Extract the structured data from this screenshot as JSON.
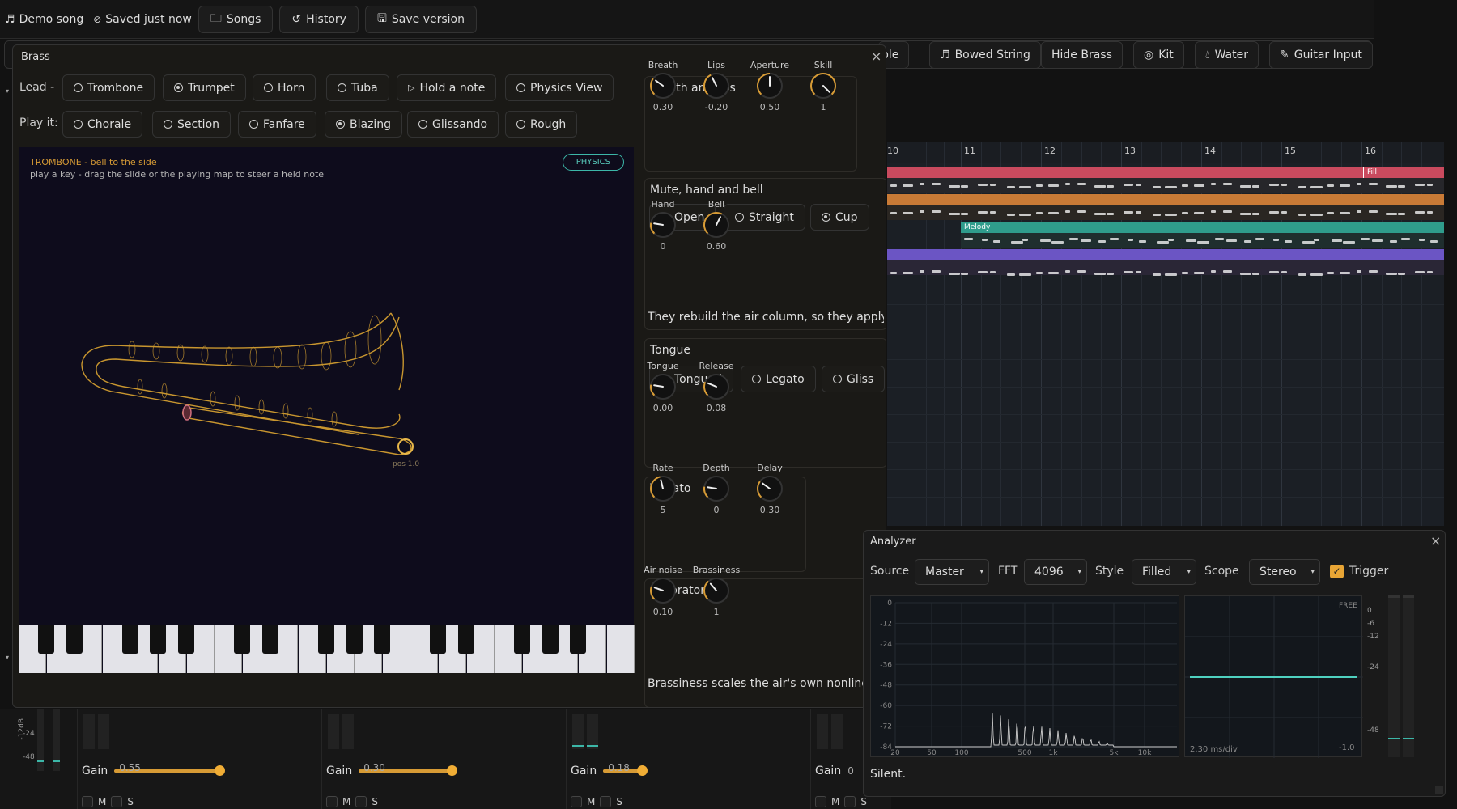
{
  "topbar": {
    "song_title": "Demo song",
    "saved_status": "Saved just now",
    "songs_label": "Songs",
    "history_label": "History",
    "save_version_label": "Save version"
  },
  "presets": {
    "partial_label": "ble",
    "bowed_string": "Bowed String",
    "hide_brass": "Hide Brass",
    "kit": "Kit",
    "water": "Water",
    "guitar_input": "Guitar Input"
  },
  "brass": {
    "title": "Brass",
    "lead_label": "Lead -",
    "lead_options": [
      {
        "label": "Trombone",
        "selected": false
      },
      {
        "label": "Trumpet",
        "selected": true
      },
      {
        "label": "Horn",
        "selected": false
      },
      {
        "label": "Tuba",
        "selected": false
      }
    ],
    "hold_note_label": "Hold a note",
    "physics_view_label": "Physics View",
    "play_it_label": "Play it:",
    "play_options": [
      {
        "label": "Chorale",
        "selected": false
      },
      {
        "label": "Section",
        "selected": false
      },
      {
        "label": "Fanfare",
        "selected": false
      },
      {
        "label": "Blazing",
        "selected": true
      },
      {
        "label": "Glissando",
        "selected": false
      },
      {
        "label": "Rough",
        "selected": false
      }
    ],
    "stage": {
      "instrument_line": "TROMBONE  -  bell to the side",
      "hint_line": "play a key - drag the slide or the playing map to steer a held note",
      "physics_badge": "PHYSICS",
      "pos_label": "pos 1.0"
    },
    "breath_and_lips": {
      "title": "Breath and lips",
      "knobs": [
        {
          "label": "Breath",
          "value": "0.30",
          "level": 0.3
        },
        {
          "label": "Lips",
          "value": "-0.20",
          "level": 0.4
        },
        {
          "label": "Aperture",
          "value": "0.50",
          "level": 0.5
        },
        {
          "label": "Skill",
          "value": "1",
          "level": 1.0
        }
      ]
    },
    "mute_hand_bell": {
      "title": "Mute, hand and bell",
      "options": [
        {
          "label": "Open",
          "selected": false
        },
        {
          "label": "Straight",
          "selected": false
        },
        {
          "label": "Cup",
          "selected": true
        }
      ],
      "knobs": [
        {
          "label": "Hand",
          "value": "0",
          "level": 0.2
        },
        {
          "label": "Bell",
          "value": "0.60",
          "level": 0.6
        }
      ],
      "note": "They rebuild the air column, so they apply f"
    },
    "tongue": {
      "title": "Tongue",
      "options": [
        {
          "label": "Tongued",
          "selected": true
        },
        {
          "label": "Legato",
          "selected": false
        },
        {
          "label": "Gliss",
          "selected": false
        }
      ],
      "knobs": [
        {
          "label": "Tongue",
          "value": "0.00",
          "level": 0.2
        },
        {
          "label": "Release",
          "value": "0.08",
          "level": 0.25
        }
      ]
    },
    "vibrato": {
      "title": "Vibrato",
      "knobs": [
        {
          "label": "Rate",
          "value": "5",
          "level": 0.45
        },
        {
          "label": "Depth",
          "value": "0",
          "level": 0.2
        },
        {
          "label": "Delay",
          "value": "0.30",
          "level": 0.3
        }
      ]
    },
    "laboratory": {
      "title": "Laboratory",
      "knobs": [
        {
          "label": "Air noise",
          "value": "0.10",
          "level": 0.24
        },
        {
          "label": "Brassiness",
          "value": "1",
          "level": 0.35
        }
      ],
      "note": "Brassiness scales the air's own nonlinea"
    }
  },
  "sequencer": {
    "bars": [
      "10",
      "11",
      "12",
      "13",
      "14",
      "15",
      "16"
    ],
    "clips": [
      {
        "label": "Fill",
        "color": "#c94a5e"
      },
      {
        "label": "",
        "color": "#c87a36"
      },
      {
        "label": "Melody",
        "color": "#2f9c8c"
      },
      {
        "label": "",
        "color": "#6b55c4"
      }
    ]
  },
  "mixer": {
    "channels": [
      {
        "gain_label": "Gain",
        "gain_value": "0.55",
        "gain": 0.55
      },
      {
        "gain_label": "Gain",
        "gain_value": "0.30",
        "gain": 0.3
      },
      {
        "gain_label": "Gain",
        "gain_value": "0.18",
        "gain": 0.18
      },
      {
        "gain_label": "Gain",
        "gain_value": "0",
        "gain": 0.0
      }
    ],
    "mute_label": "M",
    "solo_label": "S",
    "meter_ticks": [
      "-12dB",
      "-24",
      "-48"
    ]
  },
  "analyzer": {
    "title": "Analyzer",
    "source_label": "Source",
    "source_value": "Master",
    "fft_label": "FFT",
    "fft_value": "4096",
    "style_label": "Style",
    "style_value": "Filled",
    "scope_label": "Scope",
    "scope_value": "Stereo",
    "trigger_label": "Trigger",
    "trigger_checked": true,
    "spectrum_y_ticks": [
      "0",
      "-12",
      "-24",
      "-36",
      "-48",
      "-60",
      "-72",
      "-84"
    ],
    "spectrum_x_ticks": [
      "20",
      "50",
      "100",
      "500",
      "1k",
      "5k",
      "10k"
    ],
    "scope_badge": "FREE",
    "scope_time": "2.30 ms/div",
    "scope_bottom": "-1.0",
    "meter_ticks": [
      "0",
      "-6",
      "-12",
      "-24",
      "-48"
    ],
    "status": "Silent."
  },
  "colors": {
    "accent": "#e8a535",
    "teal": "#3cb7a8",
    "instrument_outline": "#c8962f"
  }
}
